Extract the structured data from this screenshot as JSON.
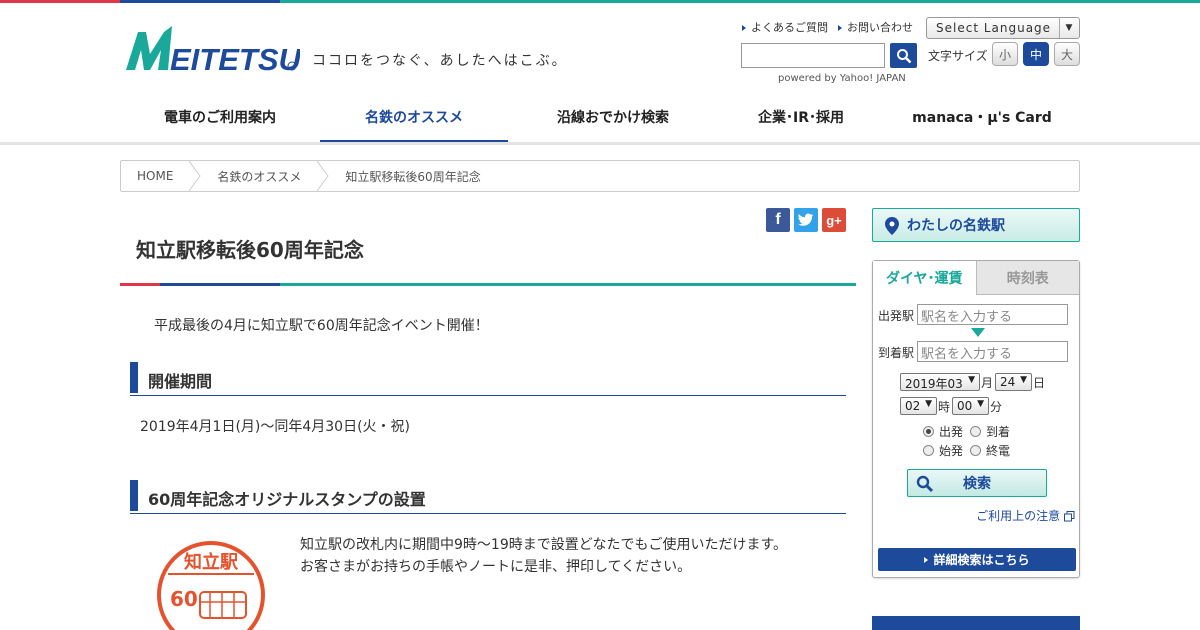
{
  "brand": {
    "logo_text": "MEITETSU",
    "tagline": "ココロをつなぐ、あしたへはこぶ。",
    "colors": {
      "red": "#e0364b",
      "navy": "#1e4a9c",
      "teal": "#1aa89a"
    }
  },
  "header": {
    "links": [
      "よくあるご質問",
      "お問い合わせ"
    ],
    "language": "Select Language",
    "powered": "powered by Yahoo! JAPAN",
    "fontsize_label": "文字サイズ",
    "fontsize": {
      "small": "小",
      "medium": "中",
      "large": "大",
      "selected": "中"
    }
  },
  "nav": [
    {
      "label": "電車のご利用案内"
    },
    {
      "label": "名鉄のオススメ"
    },
    {
      "label": "沿線おでかけ検索"
    },
    {
      "label": "企業･IR･採用"
    },
    {
      "label": "manaca・μ's Card"
    }
  ],
  "breadcrumb": [
    "HOME",
    "名鉄のオススメ",
    "知立駅移転後60周年記念"
  ],
  "main": {
    "title": "知立駅移転後60周年記念",
    "lead": "平成最後の4月に知立駅で60周年記念イベント開催！",
    "section1": {
      "heading": "開催期間",
      "body": "2019年4月1日(月)～同年4月30日(火・祝)"
    },
    "section2": {
      "heading": "60周年記念オリジナルスタンプの設置",
      "line1": "知立駅の改札内に期間中9時～19時まで設置どなたでもご使用いただけます。",
      "line2": "お客さまがお持ちの手帳やノートに是非、押印してください。"
    },
    "stamp": {
      "title": "知立駅",
      "number": "60"
    }
  },
  "sidebar": {
    "my_meitetsu": "わたしの名鉄駅",
    "tabs": [
      "ダイヤ･運賃",
      "時刻表"
    ],
    "from_label": "出発駅",
    "to_label": "到着駅",
    "station_placeholder": "駅名を入力する",
    "year_month": "2019年03",
    "month_unit": "月",
    "day": "24",
    "day_unit": "日",
    "hour": "02",
    "hour_unit": "時",
    "minute": "00",
    "minute_unit": "分",
    "radios": {
      "depart": "出発",
      "arrive": "到着",
      "first": "始発",
      "last": "終電"
    },
    "search": "検索",
    "note": "ご利用上の注意",
    "detail": "詳細検索はこちら"
  }
}
